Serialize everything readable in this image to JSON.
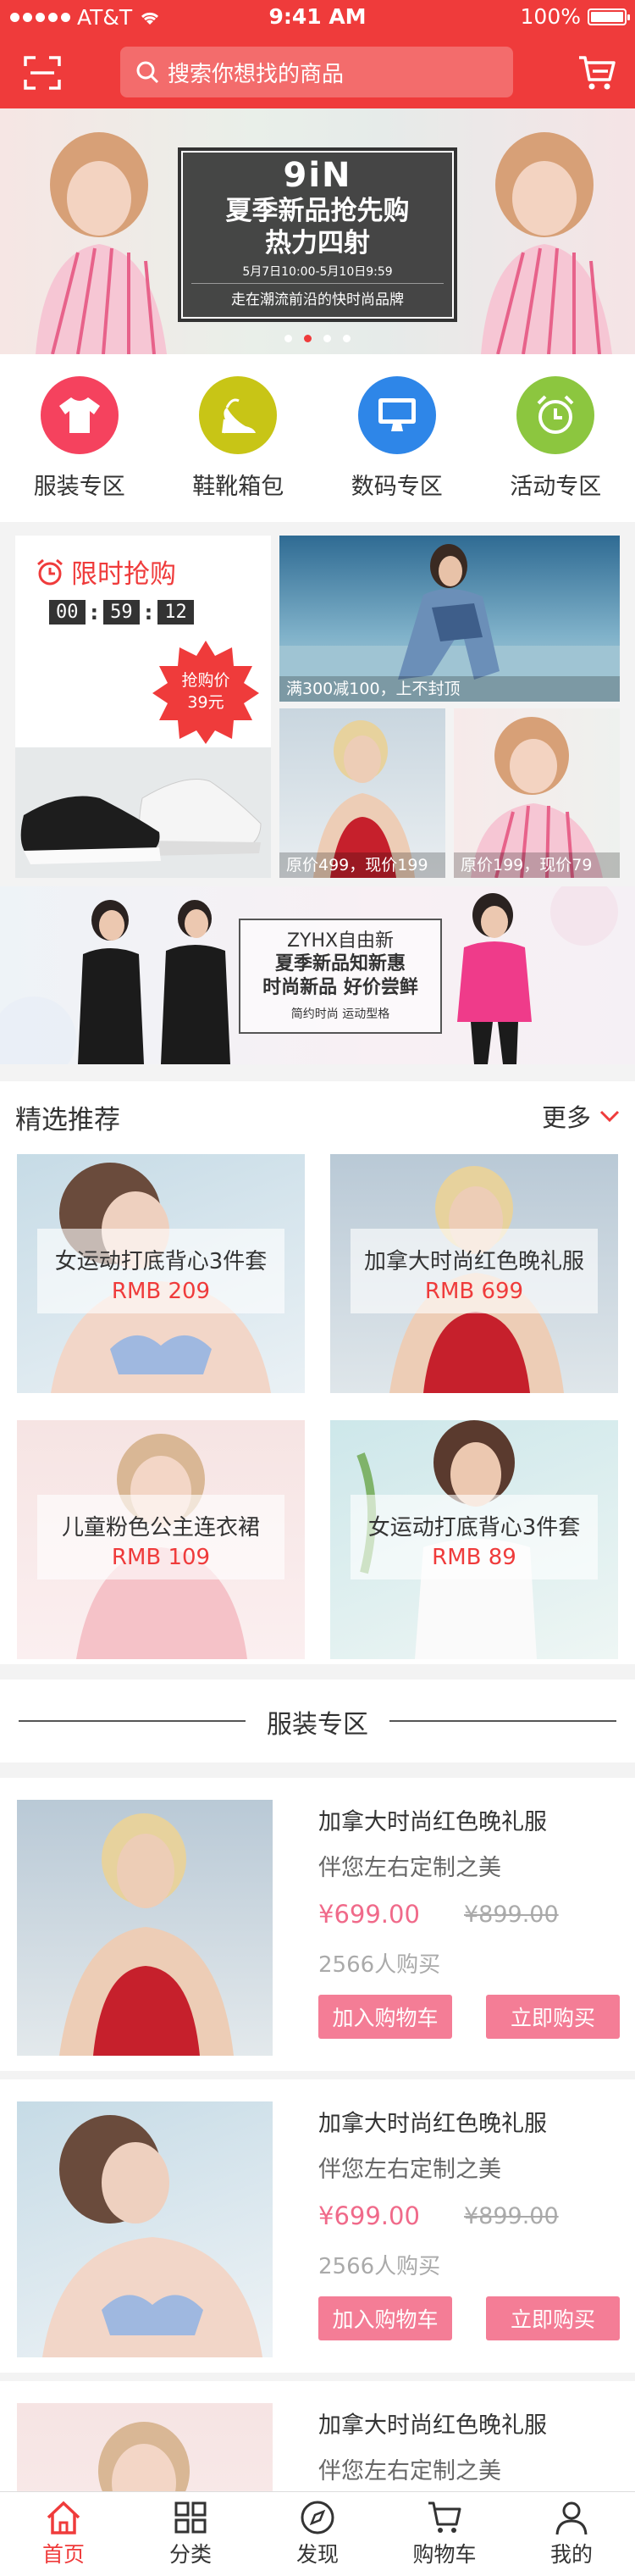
{
  "status_bar": {
    "carrier": "AT&T",
    "time": "9:41 AM",
    "battery": "100%"
  },
  "search": {
    "placeholder": "搜索你想找的商品"
  },
  "banner": {
    "brand": "9iN",
    "title1": "夏季新品抢先购",
    "title2": "热力四射",
    "date": "5月7日10:00-5月10日9:59",
    "slogan": "走在潮流前沿的快时尚品牌",
    "dots": 4,
    "active_dot": 1
  },
  "categories": [
    {
      "label": "服装专区",
      "icon": "tshirt-icon",
      "color": "#f5425e"
    },
    {
      "label": "鞋靴箱包",
      "icon": "high-heel-icon",
      "color": "#c8c516"
    },
    {
      "label": "数码专区",
      "icon": "monitor-icon",
      "color": "#2e86e8"
    },
    {
      "label": "活动专区",
      "icon": "alarm-clock-icon",
      "color": "#8cc63f"
    }
  ],
  "flash_sale": {
    "title": "限时抢购",
    "timer": [
      "00",
      "59",
      "12"
    ],
    "badge_label": "抢购价",
    "badge_price": "39元"
  },
  "promo_tiles": [
    {
      "caption": "满300减100，上不封顶"
    },
    {
      "caption": "原价499，现价199"
    },
    {
      "caption": "原价199，现价79"
    }
  ],
  "ad_banner": {
    "brand": "ZYHX自由新",
    "line1": "夏季新品知新惠",
    "line2": "时尚新品 好价尝鲜",
    "sub": "简约时尚  运动型格"
  },
  "recommend": {
    "title": "精选推荐",
    "more": "更多",
    "items": [
      {
        "name": "女运动打底背心3件套",
        "price": "RMB 209"
      },
      {
        "name": "加拿大时尚红色晚礼服",
        "price": "RMB 699"
      },
      {
        "name": "儿童粉色公主连衣裙",
        "price": "RMB 109"
      },
      {
        "name": "女运动打底背心3件套",
        "price": "RMB 89"
      }
    ]
  },
  "section": {
    "title": "服装专区",
    "products": [
      {
        "name": "加拿大时尚红色晚礼服",
        "desc": "伴您左右定制之美",
        "price": "¥699.00",
        "old_price": "¥899.00",
        "sold": "2566人购买",
        "add_cart": "加入购物车",
        "buy_now": "立即购买"
      },
      {
        "name": "加拿大时尚红色晚礼服",
        "desc": "伴您左右定制之美",
        "price": "¥699.00",
        "old_price": "¥899.00",
        "sold": "2566人购买",
        "add_cart": "加入购物车",
        "buy_now": "立即购买"
      },
      {
        "name": "加拿大时尚红色晚礼服",
        "desc": "伴您左右定制之美"
      }
    ]
  },
  "tabs": [
    {
      "label": "首页",
      "icon": "home-icon"
    },
    {
      "label": "分类",
      "icon": "grid-icon"
    },
    {
      "label": "发现",
      "icon": "compass-icon"
    },
    {
      "label": "购物车",
      "icon": "cart-icon"
    },
    {
      "label": "我的",
      "icon": "user-icon"
    }
  ],
  "colors": {
    "accent": "#ef3b3b",
    "button": "#f47d96",
    "price": "#f06a8a"
  }
}
